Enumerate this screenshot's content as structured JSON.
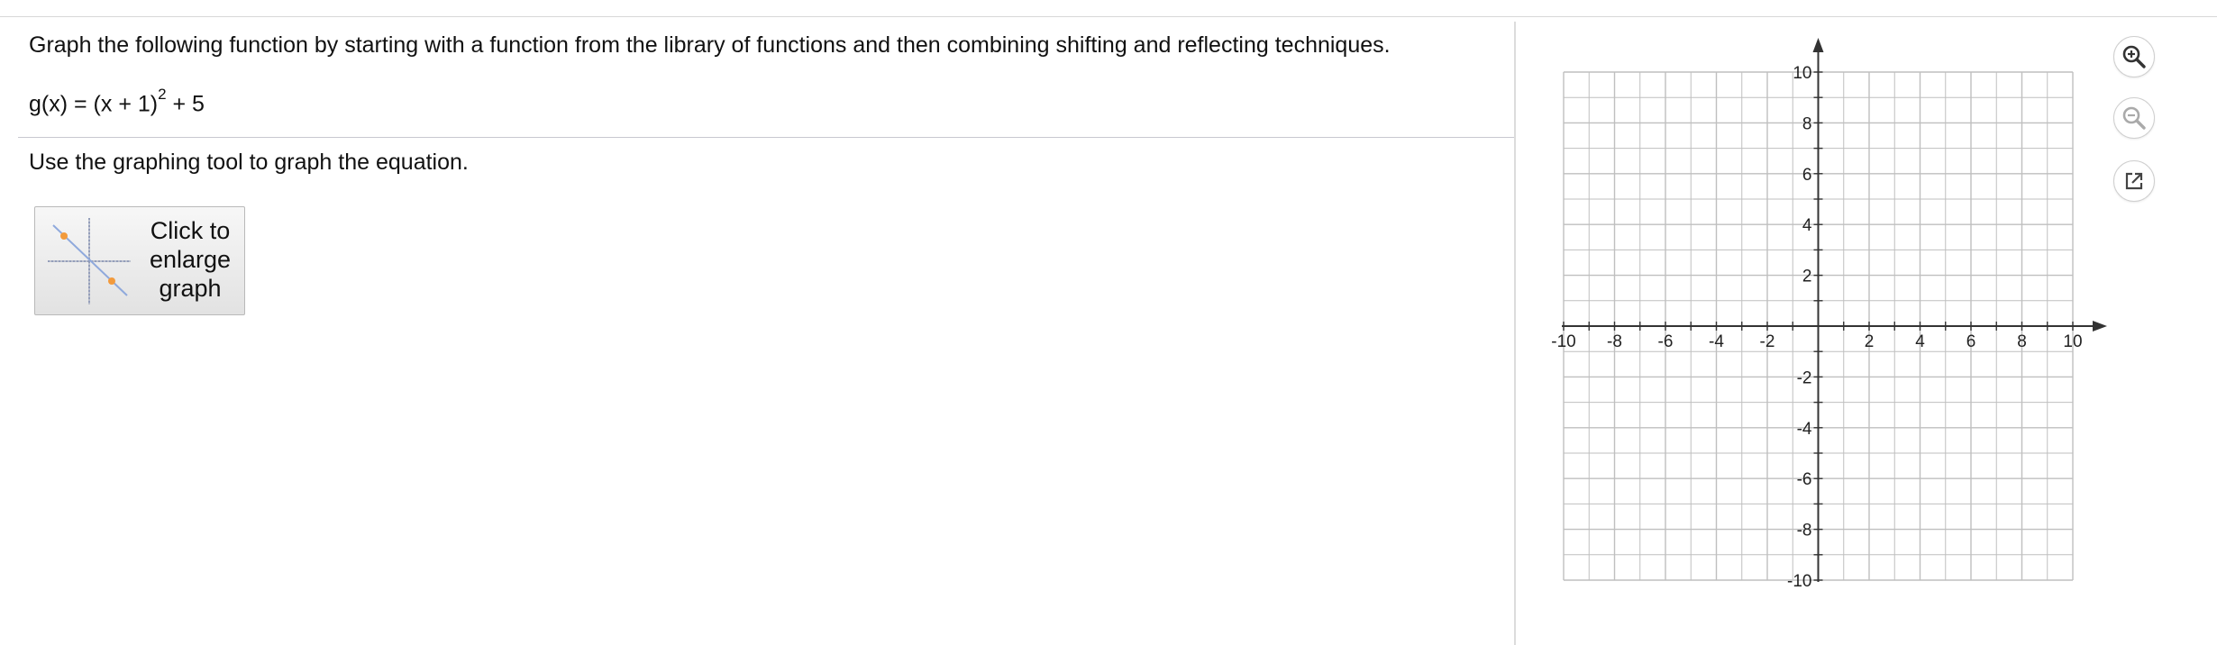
{
  "question": {
    "prompt": "Graph the following function by starting with a function from the library of functions and then combining shifting and reflecting techniques.",
    "equation_base": "g(x) = (x + 1)",
    "equation_exponent": "2",
    "equation_tail": " + 5",
    "instruction": "Use the graphing tool to graph the equation."
  },
  "enlarge_button": {
    "label": "Click to\nenlarge\ngraph"
  },
  "graph": {
    "xlim": [
      -10,
      10
    ],
    "ylim": [
      -10,
      10
    ],
    "x_tick_labels": [
      "-10",
      "-8",
      "-6",
      "-4",
      "-2",
      "2",
      "4",
      "6",
      "8",
      "10"
    ],
    "y_tick_labels": [
      "10",
      "8",
      "6",
      "4",
      "2",
      "-2",
      "-4",
      "-6",
      "-8",
      "-10"
    ],
    "grid": true
  },
  "toolbar": {
    "zoom_in_icon": "zoom-in-icon",
    "zoom_out_icon": "zoom-out-icon",
    "popout_icon": "external-window-icon"
  },
  "colors": {
    "grid": "#bfbfbf",
    "axis": "#333333",
    "tool_icon": "#444444",
    "tool_icon_disabled": "#aaaaaa"
  }
}
